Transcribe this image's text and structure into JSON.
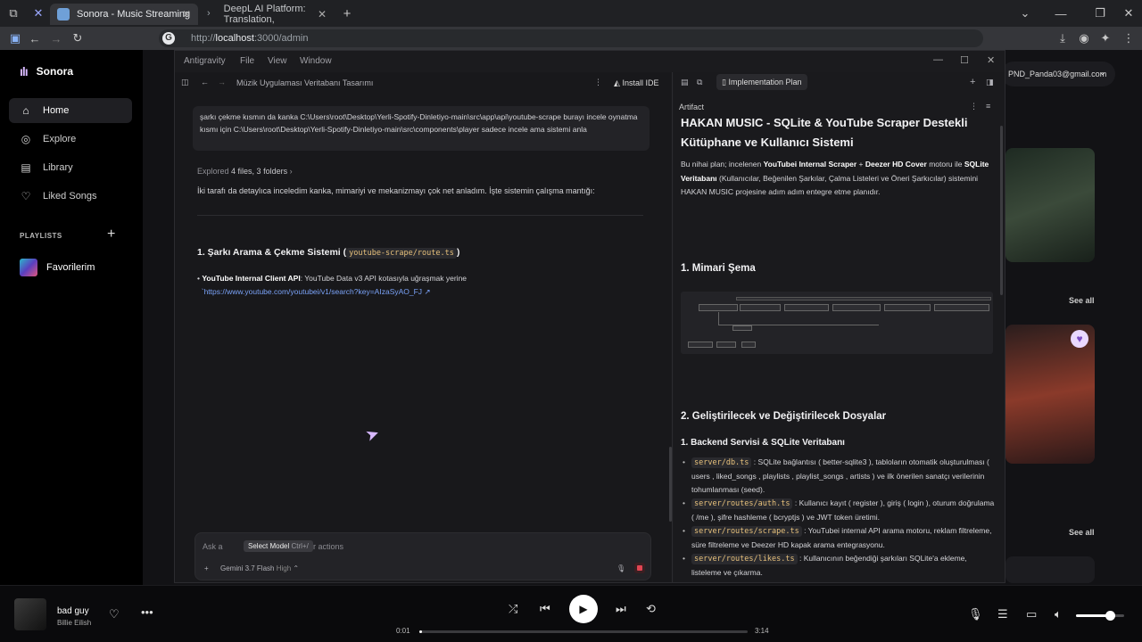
{
  "browser": {
    "tabs": [
      {
        "label": "Sonora - Music Streaming"
      },
      {
        "label": "DeepL AI Platform: Translation,"
      }
    ],
    "url_prefix": "http://",
    "url_host": "localhost",
    "url_path": ":3000/admin"
  },
  "sonora": {
    "brand": "Sonora",
    "nav": [
      "Home",
      "Explore",
      "Library",
      "Liked Songs"
    ],
    "playlists_header": "PLAYLISTS",
    "playlists": [
      "Favorilerim"
    ],
    "user_email": "PND_Panda03@gmail.com",
    "see_all": "See all",
    "player": {
      "title": "bad guy",
      "artist": "Billie Eilish",
      "elapsed": "0:01",
      "duration": "3:14",
      "progress": 0.005,
      "volume": 0.7
    }
  },
  "antigravity": {
    "menu": [
      "Antigravity",
      "File",
      "View",
      "Window"
    ],
    "conversation_title": "Müzik Uygulaması Veritabanı Tasarımı",
    "install_ide": "Install IDE",
    "tab_label": "Implementation Plan",
    "artifact_label": "Artifact",
    "user_message": "şarkı çekme kısmın da kanka C:\\Users\\root\\Desktop\\Yerli-Spotify-Dinletiyo-main\\src\\app\\api\\youtube-scrape burayı incele oynatma kısmı için C:\\Users\\root\\Desktop\\Yerli-Spotify-Dinletiyo-main\\src\\components\\player sadece incele ama sistemi anla",
    "explored_prefix": "Explored",
    "explored_detail": "4 files, 3 folders",
    "reply_intro": "İki tarafı da detaylıca inceledim kanka, mimariyi ve mekanizmayı çok net anladım. İşte sistemin çalışma mantığı:",
    "section1_title": "1. Şarkı Arama & Çekme Sistemi (",
    "section1_code": "youtube-scrape/route.ts",
    "section1_close": ")",
    "bullet1_bold": "YouTube Internal Client API",
    "bullet1_text": ": YouTube Data v3 API kotasıyla uğraşmak yerine",
    "bullet1_link": "`https://www.youtube.com/youtubei/v1/search?key=AIzaSyAO_FJ",
    "composer_placeholder_start": "Ask a",
    "composer_placeholder_end": "on, / for actions",
    "tooltip_label": "Select Model",
    "tooltip_shortcut": "Ctrl+/",
    "model": "Gemini 3.7 Flash",
    "model_level": "High",
    "artifact": {
      "title": "HAKAN MUSIC - SQLite & YouTube Scraper Destekli Kütüphane ve Kullanıcı Sistemi",
      "intro_1": "Bu nihai plan; incelenen ",
      "intro_b1": "YouTubei Internal Scraper",
      "intro_2": " + ",
      "intro_b2": "Deezer HD Cover",
      "intro_3": " motoru ile ",
      "intro_b3": "SQLite Veritabanı",
      "intro_4": " (Kullanıcılar, Beğenilen Şarkılar, Çalma Listeleri ve Öneri Şarkıcılar) sistemini HAKAN MUSIC projesine adım adım entegre etme planıdır.",
      "h_arch": "1. Mimari Şema",
      "h_files": "2. Geliştirilecek ve Değiştirilecek Dosyalar",
      "h_backend": "1. Backend Servisi & SQLite Veritabanı",
      "items": [
        {
          "code": "server/db.ts",
          "text": ": SQLite bağlantısı ( better-sqlite3 ), tabloların otomatik oluşturulması ( users , liked_songs , playlists , playlist_songs , artists ) ve ilk önerilen sanatçı verilerinin tohumlanması (seed)."
        },
        {
          "code": "server/routes/auth.ts",
          "text": ": Kullanıcı kayıt ( register ), giriş ( login ), oturum doğrulama ( /me ), şifre hashleme ( bcryptjs ) ve JWT token üretimi."
        },
        {
          "code": "server/routes/scrape.ts",
          "text": ": YouTubei internal API arama motoru, reklam filtreleme, süre filtreleme ve Deezer HD kapak arama entegrasyonu."
        },
        {
          "code": "server/routes/likes.ts",
          "text": ": Kullanıcının beğendiği şarkıları SQLite'a ekleme, listeleme ve çıkarma."
        }
      ]
    }
  }
}
